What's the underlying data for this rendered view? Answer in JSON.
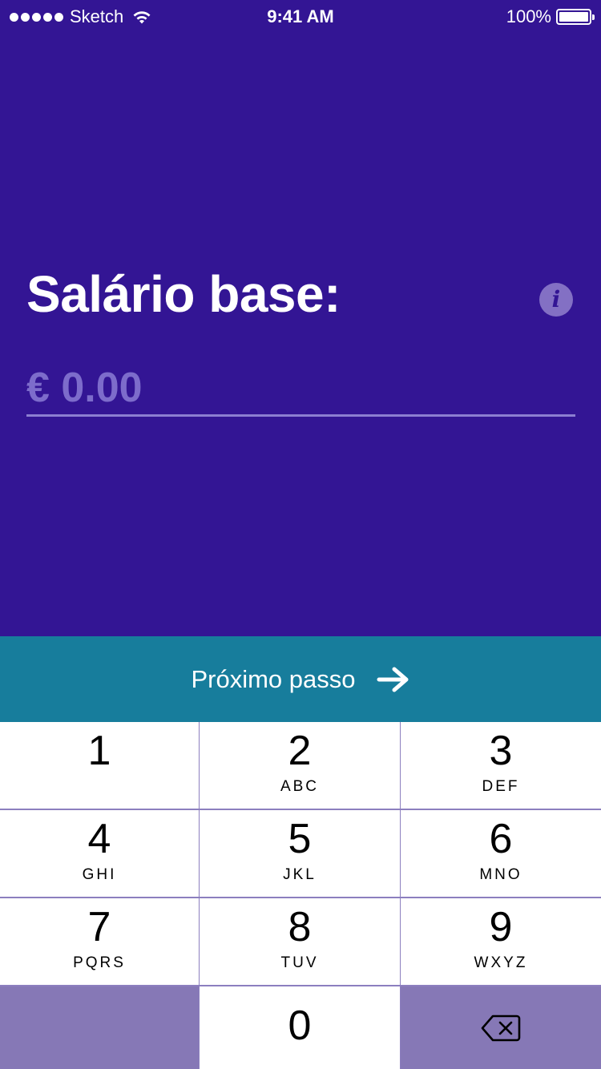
{
  "status_bar": {
    "carrier": "Sketch",
    "time": "9:41 AM",
    "battery_percent": "100%",
    "signal_dots": 5,
    "icons": [
      "signal-dots-icon",
      "wifi-icon",
      "battery-icon"
    ]
  },
  "form": {
    "title": "Salário base:",
    "info_icon_glyph": "i",
    "amount_placeholder": "€ 0.00",
    "amount_value": ""
  },
  "next_button": {
    "label": "Próximo passo",
    "icon": "arrow-right-icon"
  },
  "keypad": {
    "keys": [
      {
        "digit": "1",
        "letters": ""
      },
      {
        "digit": "2",
        "letters": "ABC"
      },
      {
        "digit": "3",
        "letters": "DEF"
      },
      {
        "digit": "4",
        "letters": "GHI"
      },
      {
        "digit": "5",
        "letters": "JKL"
      },
      {
        "digit": "6",
        "letters": "MNO"
      },
      {
        "digit": "7",
        "letters": "PQRS"
      },
      {
        "digit": "8",
        "letters": "TUV"
      },
      {
        "digit": "9",
        "letters": "WXYZ"
      },
      {
        "digit": "0",
        "letters": ""
      }
    ],
    "delete_icon": "backspace-icon"
  },
  "colors": {
    "background": "#331594",
    "next_button": "#177d9c",
    "keypad_special_key": "#8678b6",
    "input_text": "#7d6ccb",
    "info_button": "#8370c4"
  }
}
